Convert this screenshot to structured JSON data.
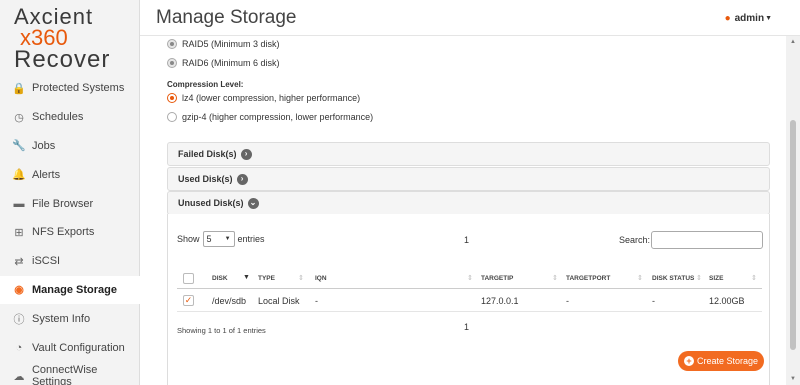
{
  "app": {
    "logo": {
      "line1": "Axcient",
      "line2": "x360",
      "line3": "Recover"
    },
    "brand_color": "#f26b21"
  },
  "sidebar": {
    "items": [
      {
        "label": "Protected Systems",
        "icon": "lock-icon",
        "glyph": "🔒"
      },
      {
        "label": "Schedules",
        "icon": "clock-icon",
        "glyph": "◷"
      },
      {
        "label": "Jobs",
        "icon": "wrench-icon",
        "glyph": "🔧"
      },
      {
        "label": "Alerts",
        "icon": "bell-icon",
        "glyph": "🔔"
      },
      {
        "label": "File Browser",
        "icon": "folder-icon",
        "glyph": "▬"
      },
      {
        "label": "NFS Exports",
        "icon": "network-icon",
        "glyph": "⊞"
      },
      {
        "label": "iSCSI",
        "icon": "share-icon",
        "glyph": "⇄"
      },
      {
        "label": "Manage Storage",
        "icon": "storage-icon",
        "glyph": "◉",
        "active": true
      },
      {
        "label": "System Info",
        "icon": "info-icon",
        "glyph": "ⓘ"
      },
      {
        "label": "Vault Configuration",
        "icon": "gauge-icon",
        "glyph": "◔"
      },
      {
        "label": "ConnectWise Settings",
        "icon": "cloud-icon",
        "glyph": "☁"
      }
    ]
  },
  "header": {
    "title": "Manage Storage",
    "user": "admin"
  },
  "raid": {
    "options": [
      {
        "label": "RAID5 (Minimum 3 disk)",
        "state": "disabled"
      },
      {
        "label": "RAID6 (Minimum 6 disk)",
        "state": "disabled"
      }
    ]
  },
  "compression": {
    "label": "Compression Level:",
    "options": [
      {
        "label": "lz4 (lower compression, higher performance)",
        "selected": true
      },
      {
        "label": "gzip-4 (higher compression, lower performance)",
        "selected": false
      }
    ]
  },
  "panels": {
    "failed": "Failed Disk(s)",
    "used": "Used Disk(s)",
    "unused": "Unused Disk(s)"
  },
  "table": {
    "show_label": "Show",
    "page_size": "5",
    "entries_label": "entries",
    "search_label": "Search:",
    "page_top": "1",
    "page_bottom": "1",
    "columns": [
      "DISK",
      "TYPE",
      "IQN",
      "TARGETIP",
      "TARGETPORT",
      "DISK STATUS",
      "SIZE"
    ],
    "rows": [
      {
        "disk": "/dev/sdb",
        "type": "Local Disk",
        "iqn": "-",
        "targetip": "127.0.0.1",
        "targetport": "-",
        "status": "-",
        "size": "12.00GB",
        "checked": true
      }
    ],
    "info": "Showing 1 to 1 of 1 entries"
  },
  "actions": {
    "create_storage": "Create Storage"
  }
}
